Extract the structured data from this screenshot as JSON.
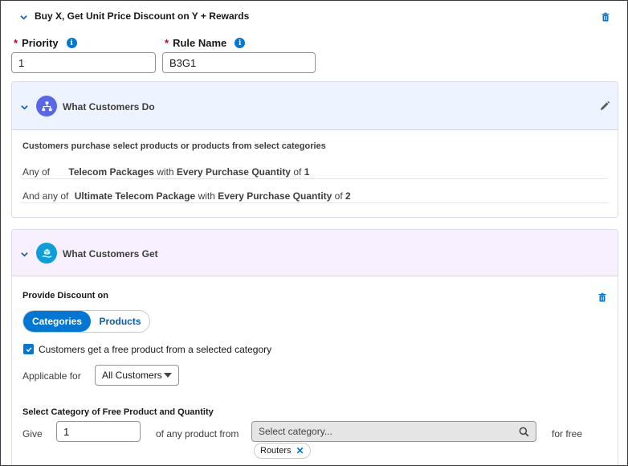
{
  "header": {
    "title": "Buy X, Get Unit Price Discount on Y + Rewards"
  },
  "fields": {
    "priority_label": "Priority",
    "priority_value": "1",
    "rule_name_label": "Rule Name",
    "rule_name_value": "B3G1",
    "required_marker": "*",
    "info_glyph": "i"
  },
  "customers_do": {
    "title": "What Customers Do",
    "description": "Customers purchase select products or products from select categories",
    "rows": [
      {
        "prefix": "Any of",
        "item": "Telecom Packages",
        "with": "with",
        "condition": "Every Purchase Quantity",
        "of": "of",
        "qty": "1"
      },
      {
        "prefix": "And any of",
        "item": "Ultimate Telecom Package",
        "with": "with",
        "condition": "Every Purchase Quantity",
        "of": "of",
        "qty": "2"
      }
    ]
  },
  "customers_get": {
    "title": "What Customers Get",
    "provide_label": "Provide Discount on",
    "tabs": [
      "Categories",
      "Products"
    ],
    "active_tab": "Categories",
    "checkbox_label": "Customers get a free product from a selected category",
    "checkbox_checked": true,
    "applicable_label": "Applicable for",
    "applicable_value": "All Customers",
    "free_section_title": "Select Category of Free Product and Quantity",
    "give_label": "Give",
    "give_value": "1",
    "any_product_from": "of any product from",
    "category_placeholder": "Select category...",
    "for_free": "for free",
    "selected_pills": [
      "Routers"
    ],
    "pill_remove_glyph": "✕"
  },
  "colors": {
    "accent": "#0176d3",
    "link": "#0b5cab",
    "do_header_bg": "#eef4ff",
    "get_header_bg": "#f9f0ff",
    "do_icon_bg": "#5867e8",
    "get_icon_bg": "#0d9dda",
    "required": "#ba0517"
  },
  "icons": {
    "collapse": "chevron-down-icon",
    "delete": "trash-icon",
    "edit": "pencil-icon",
    "do_icon": "hierarchy-icon",
    "get_icon": "product-hand-icon",
    "search": "search-icon",
    "dropdown": "caret-down-icon",
    "info": "info-icon",
    "check": "check-icon",
    "remove": "close-icon"
  }
}
